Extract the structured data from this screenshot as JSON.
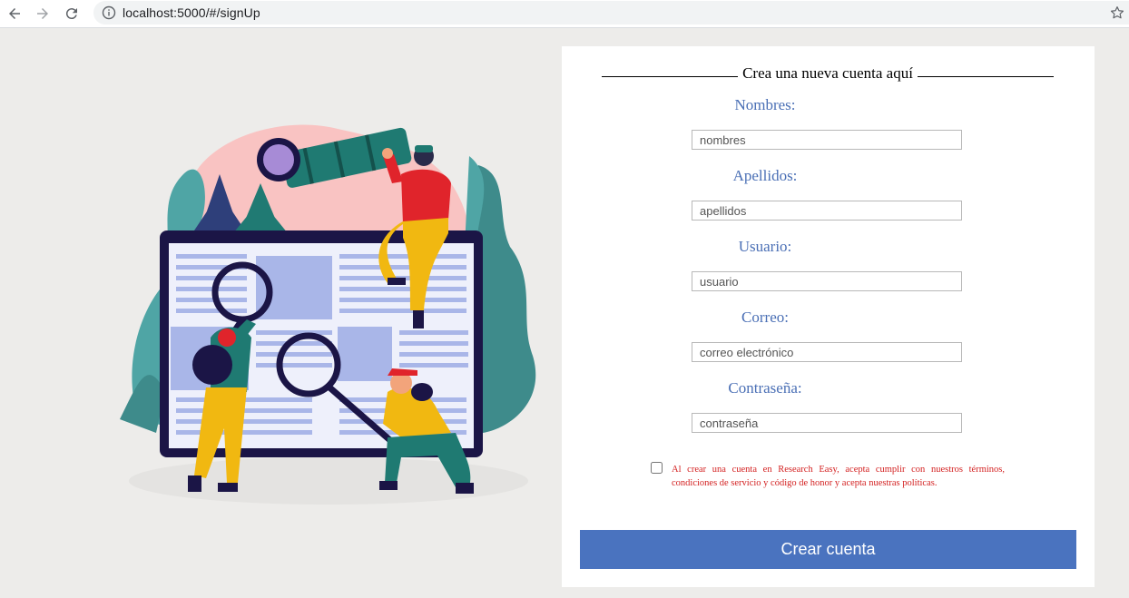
{
  "browser": {
    "url": "localhost:5000/#/signUp",
    "icons": [
      "back-arrow-icon",
      "forward-arrow-icon",
      "reload-icon",
      "info-icon",
      "star-icon"
    ]
  },
  "form": {
    "heading": "Crea una nueva cuenta aquí",
    "fields": [
      {
        "label": "Nombres:",
        "placeholder": "nombres"
      },
      {
        "label": "Apellidos:",
        "placeholder": "apellidos"
      },
      {
        "label": "Usuario:",
        "placeholder": "usuario"
      },
      {
        "label": "Correo:",
        "placeholder": "correo electrónico"
      },
      {
        "label": "Contraseña:",
        "placeholder": "contraseña"
      }
    ],
    "terms_text": "Al crear una cuenta en Research Easy, acepta cumplir con nuestros términos, condiciones de servicio y código de honor y acepta nuestras políticas.",
    "submit_label": "Crear cuenta"
  },
  "colors": {
    "page_bg": "#edecea",
    "label": "#4a6fb5",
    "button": "#4a73bf",
    "terms": "#d31f1f"
  }
}
